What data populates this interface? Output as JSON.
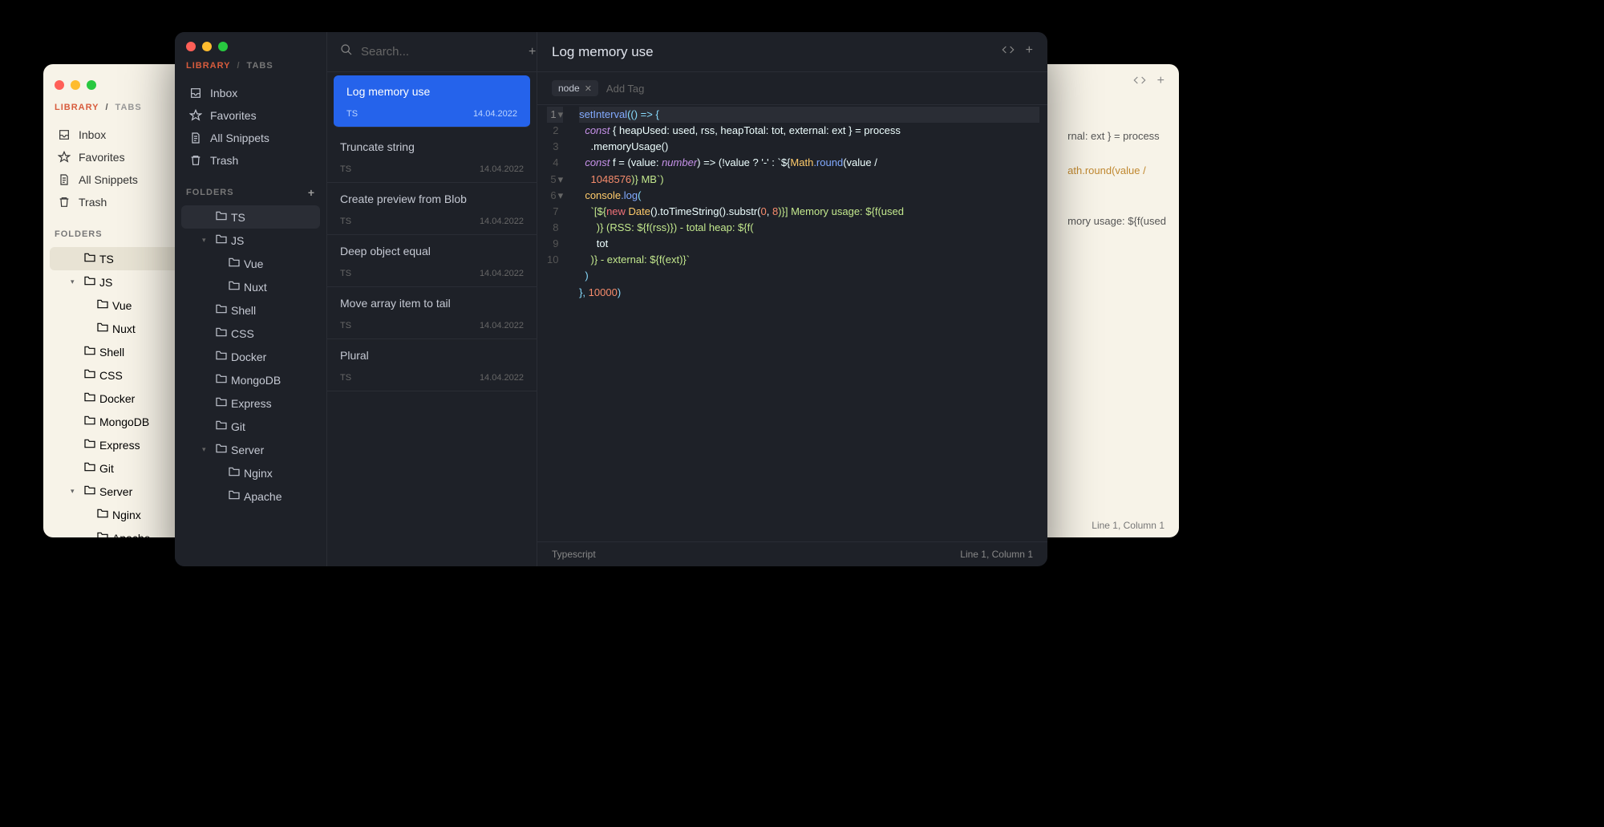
{
  "breadcrumb": {
    "library": "LIBRARY",
    "tabs": "TABS",
    "sep": "/"
  },
  "nav": {
    "inbox": "Inbox",
    "favorites": "Favorites",
    "allSnippets": "All Snippets",
    "trash": "Trash"
  },
  "folders": {
    "header": "FOLDERS",
    "items": [
      {
        "name": "TS",
        "selected": true,
        "indent": 1
      },
      {
        "name": "JS",
        "expanded": true,
        "indent": 1
      },
      {
        "name": "Vue",
        "indent": 2
      },
      {
        "name": "Nuxt",
        "indent": 2
      },
      {
        "name": "Shell",
        "indent": 1
      },
      {
        "name": "CSS",
        "indent": 1
      },
      {
        "name": "Docker",
        "indent": 1
      },
      {
        "name": "MongoDB",
        "indent": 1
      },
      {
        "name": "Express",
        "indent": 1
      },
      {
        "name": "Git",
        "indent": 1
      },
      {
        "name": "Server",
        "expanded": true,
        "indent": 1
      },
      {
        "name": "Nginx",
        "indent": 2
      },
      {
        "name": "Apache",
        "indent": 2
      }
    ]
  },
  "search": {
    "placeholder": "Search..."
  },
  "snippets": [
    {
      "title": "Log memory use",
      "lang": "TS",
      "date": "14.04.2022",
      "selected": true
    },
    {
      "title": "Truncate string",
      "lang": "TS",
      "date": "14.04.2022"
    },
    {
      "title": "Create preview from Blob",
      "lang": "TS",
      "date": "14.04.2022"
    },
    {
      "title": "Deep object equal",
      "lang": "TS",
      "date": "14.04.2022"
    },
    {
      "title": "Move array item to tail",
      "lang": "TS",
      "date": "14.04.2022"
    },
    {
      "title": "Plural",
      "lang": "TS",
      "date": "14.04.2022"
    }
  ],
  "editor": {
    "title": "Log memory use",
    "tag": "node",
    "addTag": "Add Tag",
    "language": "Typescript",
    "cursor": "Line 1, Column 1",
    "lines": [
      {
        "n": 1,
        "fold": true
      },
      {
        "n": 2
      },
      {
        "n": 3
      },
      {
        "n": 4
      },
      {
        "n": 5,
        "fold": true
      },
      {
        "n": 6,
        "fold": true
      },
      {
        "n": 7
      },
      {
        "n": 8
      },
      {
        "n": 9
      },
      {
        "n": 10
      }
    ],
    "code": {
      "l1": "setInterval(() => {",
      "l2a": "const",
      "l2b": " { heapUsed: used, rss, heapTotal: tot, external: ext } = process",
      "l2c": ".memoryUsage()",
      "l3a": "const",
      "l3b": " f = (value: ",
      "l3c": "number",
      "l3d": ") => (!value ? '-' : `${",
      "l3e": "Math",
      "l3f": ".round",
      "l3g": "(value / ",
      "l3h": "1048576",
      "l3i": ")} MB`)",
      "l5a": "console",
      "l5b": ".log",
      "l5c": "(",
      "l6a": "`[${",
      "l6b": "new",
      "l6c": " Date",
      "l6d": "().toTimeString().substr(",
      "l6e": "0",
      "l6f": ", ",
      "l6g": "8",
      "l6h": ")}] Memory usage: ${f(used",
      "l6i": ")} (RSS: ${f(rss)}) - total heap: ${f(",
      "l7": "tot",
      "l8": ")} - external: ${f(ext)}`",
      "l9": ")",
      "l10a": "}, ",
      "l10b": "10000",
      "l10c": ")"
    }
  },
  "light": {
    "cursor": "Line 1, Column 1",
    "peek1": "rnal: ext } = process",
    "peek2": "ath.round(value /",
    "peek3": "mory usage: ${f(used"
  }
}
